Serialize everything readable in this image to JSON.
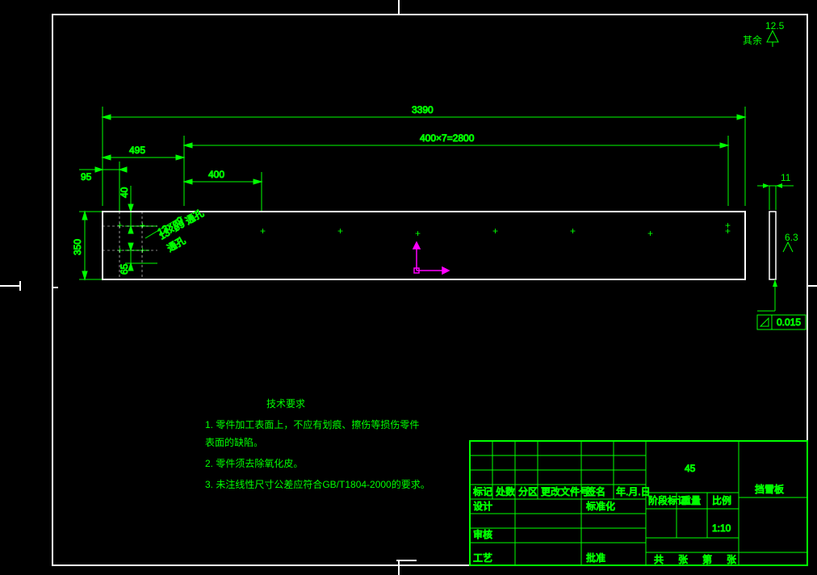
{
  "surface_note": {
    "prefix": "其余",
    "value": "12.5"
  },
  "dims": {
    "overall": "3390",
    "array": "400×7=2800",
    "left_offset": "495",
    "hole_pitch": "400",
    "left_edge": "95",
    "top_row": "40",
    "height": "350",
    "bottom_row": "65",
    "thickness": "11",
    "hole_note": "13×ø9\n通孔",
    "side_ra": "6.3",
    "flatness": "0.015"
  },
  "tech": {
    "title": "技术要求",
    "lines": [
      "1. 零件加工表面上，不应有划痕、擦伤等损伤零件",
      "   表面的缺陷。",
      "2. 零件须去除氧化皮。",
      "3. 未注线性尺寸公差应符合GB/T1804-2000的要求。"
    ]
  },
  "title_block": {
    "part_name": "挡雪板",
    "material": "45",
    "row_hdr": {
      "mark": "标记",
      "qty": "处数",
      "zone": "分区",
      "chg": "更改文件号",
      "sign": "签名",
      "date": "年.月.日"
    },
    "rows": {
      "design": "设计",
      "std": "标准化",
      "check": "审核",
      "proc": "工艺",
      "approve": "批准"
    },
    "right_hdr": {
      "stage": "阶段标记",
      "weight": "重量",
      "scale": "比例"
    },
    "scale": "1:10",
    "sheets": {
      "gong": "共",
      "zhang1": "张",
      "di": "第",
      "zhang2": "张"
    }
  }
}
